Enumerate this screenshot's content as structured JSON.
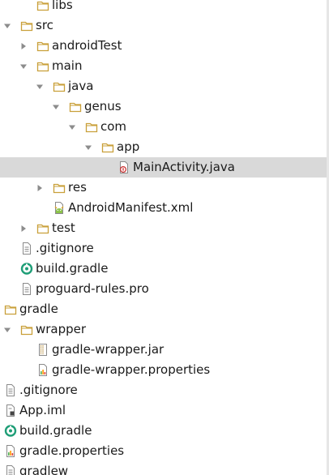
{
  "tree": {
    "nodes": [
      {
        "name": "folder-libs",
        "label": "libs",
        "icon": "folder-icon",
        "toggle": "none",
        "depth": 3
      },
      {
        "name": "folder-src",
        "label": "src",
        "icon": "folder-icon",
        "toggle": "expanded",
        "depth": 2
      },
      {
        "name": "folder-androidTest",
        "label": "androidTest",
        "icon": "folder-icon",
        "toggle": "collapsed",
        "depth": 3
      },
      {
        "name": "folder-main",
        "label": "main",
        "icon": "folder-icon",
        "toggle": "expanded",
        "depth": 3
      },
      {
        "name": "folder-java",
        "label": "java",
        "icon": "folder-icon",
        "toggle": "expanded",
        "depth": 4
      },
      {
        "name": "folder-genus",
        "label": "genus",
        "icon": "folder-icon",
        "toggle": "expanded",
        "depth": 5
      },
      {
        "name": "folder-com",
        "label": "com",
        "icon": "folder-icon",
        "toggle": "expanded",
        "depth": 6
      },
      {
        "name": "folder-app",
        "label": "app",
        "icon": "folder-icon",
        "toggle": "expanded",
        "depth": 7
      },
      {
        "name": "file-mainactivity",
        "label": "MainActivity.java",
        "icon": "java-class-icon",
        "toggle": "none",
        "depth": 8,
        "selected": true
      },
      {
        "name": "folder-res",
        "label": "res",
        "icon": "folder-icon",
        "toggle": "collapsed",
        "depth": 4
      },
      {
        "name": "file-androidmanifest",
        "label": "AndroidManifest.xml",
        "icon": "android-manifest-icon",
        "toggle": "none",
        "depth": 4
      },
      {
        "name": "folder-test",
        "label": "test",
        "icon": "folder-icon",
        "toggle": "collapsed",
        "depth": 3
      },
      {
        "name": "file-gitignore-app",
        "label": ".gitignore",
        "icon": "text-file-icon",
        "toggle": "none",
        "depth": 2
      },
      {
        "name": "file-build-gradle-app",
        "label": "build.gradle",
        "icon": "gradle-icon",
        "toggle": "none",
        "depth": 2
      },
      {
        "name": "file-proguard-rules",
        "label": "proguard-rules.pro",
        "icon": "text-file-icon",
        "toggle": "none",
        "depth": 2
      },
      {
        "name": "folder-gradle",
        "label": "gradle",
        "icon": "folder-icon",
        "toggle": "expanded",
        "depth": 1
      },
      {
        "name": "folder-wrapper",
        "label": "wrapper",
        "icon": "folder-icon",
        "toggle": "expanded",
        "depth": 2
      },
      {
        "name": "file-gradle-wrapper-jar",
        "label": "gradle-wrapper.jar",
        "icon": "jar-icon",
        "toggle": "none",
        "depth": 3
      },
      {
        "name": "file-gradle-wrapper-properties",
        "label": "gradle-wrapper.properties",
        "icon": "properties-file-icon",
        "toggle": "none",
        "depth": 3
      },
      {
        "name": "file-gitignore-root",
        "label": ".gitignore",
        "icon": "text-file-icon",
        "toggle": "none",
        "depth": 1
      },
      {
        "name": "file-app-iml",
        "label": "App.iml",
        "icon": "iml-file-icon",
        "toggle": "none",
        "depth": 1
      },
      {
        "name": "file-build-gradle-root",
        "label": "build.gradle",
        "icon": "gradle-icon",
        "toggle": "none",
        "depth": 1
      },
      {
        "name": "file-gradle-properties",
        "label": "gradle.properties",
        "icon": "properties-file-icon",
        "toggle": "none",
        "depth": 1
      },
      {
        "name": "file-gradlew",
        "label": "gradlew",
        "icon": "text-file-icon",
        "toggle": "none",
        "depth": 1
      }
    ]
  },
  "colors": {
    "selection": "#d9d9d9",
    "folder": "#c9a03a",
    "arrow": "#8c8c8c",
    "gradle": "#1f9e77",
    "java_badge": "#cc3333"
  }
}
